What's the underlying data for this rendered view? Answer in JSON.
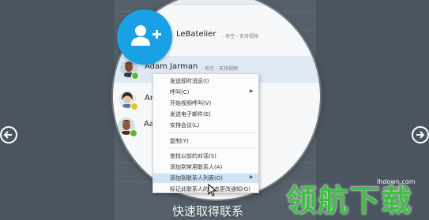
{
  "contacts": [
    {
      "name": "LeBatelier",
      "status": "- 有空 - 支持视频",
      "presence_color": "#5db539"
    },
    {
      "name": "Adam Jarman",
      "status": "- 有空 - 支持视频",
      "presence_color": "#5db539"
    },
    {
      "name": "Ar",
      "status": "",
      "presence_color": "#f4c021"
    },
    {
      "name": "Aa",
      "status": "",
      "presence_color": "#5db539"
    }
  ],
  "context_menu": {
    "items": [
      {
        "label": "发送即时消息(I)",
        "has_submenu": false
      },
      {
        "label": "呼叫(C)",
        "has_submenu": true
      },
      {
        "label": "开始视频呼叫(V)",
        "has_submenu": false
      },
      {
        "label": "发送电子邮件(E)",
        "has_submenu": false
      },
      {
        "label": "安排会议(L)",
        "has_submenu": false
      },
      {
        "label": "复制(Y)",
        "has_submenu": false
      },
      {
        "label": "查找以前的对话(S)",
        "has_submenu": false
      },
      {
        "label": "添加到常用联系人(A)",
        "has_submenu": false
      },
      {
        "label": "添加到联系人列表(O)",
        "has_submenu": true,
        "selected": true
      },
      {
        "label": "标记此联系人的状态更改通知(G)",
        "has_submenu": false
      }
    ]
  },
  "caption": "快速取得联系",
  "watermark": {
    "text": "领航下载",
    "url": "lhdown.com"
  },
  "colors": {
    "accent_blue": "#1aa0e4",
    "available_green": "#5db539",
    "away_yellow": "#f4c021",
    "watermark_green": "#3fbd44"
  },
  "icons": {
    "add_contact": "add-contact-icon",
    "nav_left": "arrow-left-icon",
    "nav_right": "arrow-right-icon",
    "cursor": "mouse-pointer-icon"
  }
}
